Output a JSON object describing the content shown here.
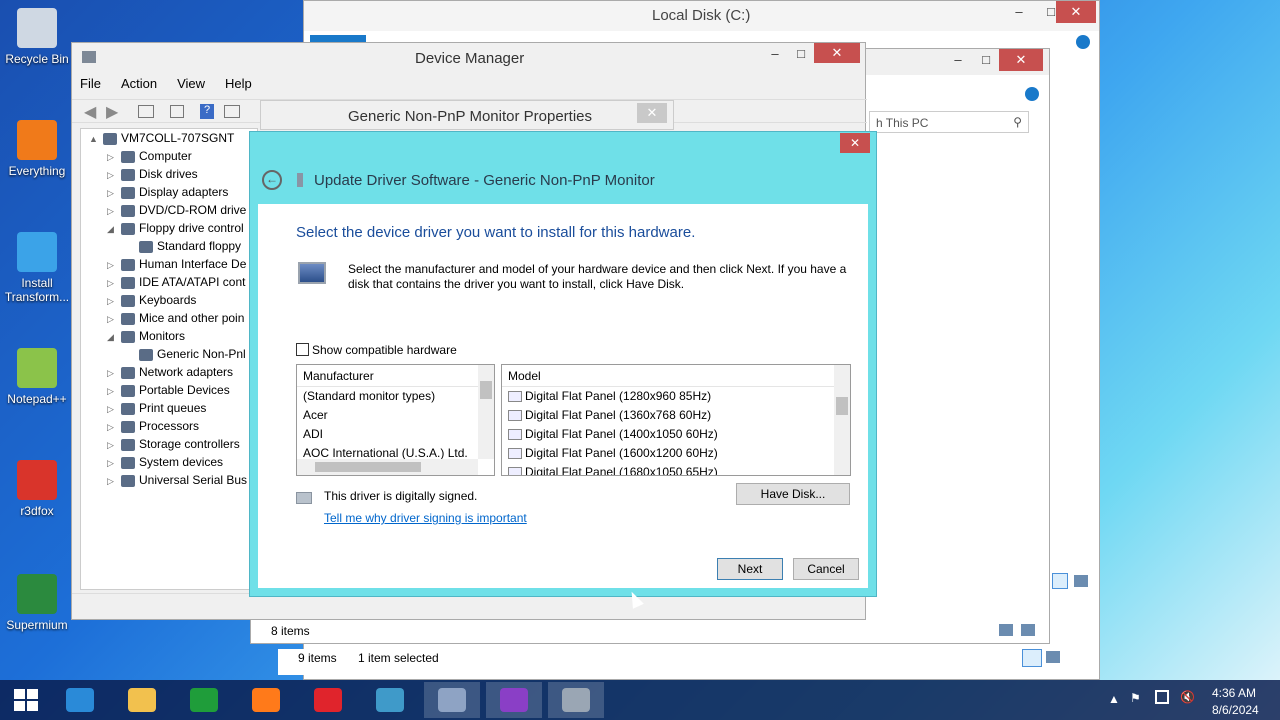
{
  "desktop": {
    "icons": [
      {
        "label": "Recycle Bin",
        "icon": "recycle-bin-icon",
        "color": "#cfd8e3"
      },
      {
        "label": "Everything",
        "icon": "everything-icon",
        "color": "#f07a1a"
      },
      {
        "label": "Install Transform...",
        "icon": "install-icon",
        "color": "#3ba3e8"
      },
      {
        "label": "Notepad++",
        "icon": "notepadpp-icon",
        "color": "#8bc34a"
      },
      {
        "label": "r3dfox",
        "icon": "r3dfox-icon",
        "color": "#d9342b"
      },
      {
        "label": "Supermium",
        "icon": "supermium-icon",
        "color": "#2b8a3e"
      }
    ]
  },
  "explorer_back": {
    "title": "Local Disk (C:)",
    "status_items": "9 items",
    "status_selected": "1 item selected"
  },
  "explorer_mid": {
    "search_placeholder": "h This PC",
    "status_items": "8 items"
  },
  "device_manager": {
    "title": "Device Manager",
    "menu": [
      "File",
      "Action",
      "View",
      "Help"
    ],
    "tree": [
      {
        "label": "VM7COLL-707SGNT",
        "level": 0,
        "arrow": "▲"
      },
      {
        "label": "Computer",
        "level": 1,
        "arrow": "▷"
      },
      {
        "label": "Disk drives",
        "level": 1,
        "arrow": "▷"
      },
      {
        "label": "Display adapters",
        "level": 1,
        "arrow": "▷"
      },
      {
        "label": "DVD/CD-ROM drive",
        "level": 1,
        "arrow": "▷"
      },
      {
        "label": "Floppy drive control",
        "level": 1,
        "arrow": "◢"
      },
      {
        "label": "Standard floppy",
        "level": 2,
        "arrow": ""
      },
      {
        "label": "Human Interface De",
        "level": 1,
        "arrow": "▷"
      },
      {
        "label": "IDE ATA/ATAPI cont",
        "level": 1,
        "arrow": "▷"
      },
      {
        "label": "Keyboards",
        "level": 1,
        "arrow": "▷"
      },
      {
        "label": "Mice and other poin",
        "level": 1,
        "arrow": "▷"
      },
      {
        "label": "Monitors",
        "level": 1,
        "arrow": "◢"
      },
      {
        "label": "Generic Non-Pnl",
        "level": 2,
        "arrow": ""
      },
      {
        "label": "Network adapters",
        "level": 1,
        "arrow": "▷"
      },
      {
        "label": "Portable Devices",
        "level": 1,
        "arrow": "▷"
      },
      {
        "label": "Print queues",
        "level": 1,
        "arrow": "▷"
      },
      {
        "label": "Processors",
        "level": 1,
        "arrow": "▷"
      },
      {
        "label": "Storage controllers",
        "level": 1,
        "arrow": "▷"
      },
      {
        "label": "System devices",
        "level": 1,
        "arrow": "▷"
      },
      {
        "label": "Universal Serial Bus",
        "level": 1,
        "arrow": "▷"
      }
    ]
  },
  "props": {
    "title": "Generic Non-PnP Monitor Properties"
  },
  "dialog": {
    "title": "Update Driver Software - Generic Non-PnP Monitor",
    "heading": "Select the device driver you want to install for this hardware.",
    "instructions": "Select the manufacturer and model of your hardware device and then click Next. If you have a disk that contains the driver you want to install, click Have Disk.",
    "checkbox_label": "Show compatible hardware",
    "manufacturer_header": "Manufacturer",
    "manufacturers": [
      "(Standard monitor types)",
      "Acer",
      "ADI",
      "AOC International (U.S.A.) Ltd."
    ],
    "model_header": "Model",
    "models": [
      "Digital Flat Panel (1280x960 85Hz)",
      "Digital Flat Panel (1360x768 60Hz)",
      "Digital Flat Panel (1400x1050 60Hz)",
      "Digital Flat Panel (1600x1200 60Hz)",
      "Digital Flat Panel (1680x1050 65Hz)"
    ],
    "signed_text": "This driver is digitally signed.",
    "link": "Tell me why driver signing is important",
    "have_disk": "Have Disk...",
    "next": "Next",
    "cancel": "Cancel"
  },
  "taskbar": {
    "time": "4:36 AM",
    "date": "8/6/2024",
    "apps": [
      {
        "icon": "internet-explorer-icon",
        "color": "#2a8ad8"
      },
      {
        "icon": "file-explorer-icon",
        "color": "#f2c14e"
      },
      {
        "icon": "store-icon",
        "color": "#1f9d3a"
      },
      {
        "icon": "firefox-icon",
        "color": "#ff7a1a"
      },
      {
        "icon": "opera-icon",
        "color": "#e0242c"
      },
      {
        "icon": "photos-icon",
        "color": "#3f9ac9"
      },
      {
        "icon": "keyboard-icon",
        "color": "#8ea3c4"
      },
      {
        "icon": "magnifier-icon",
        "color": "#8a3fc6"
      },
      {
        "icon": "device-manager-icon",
        "color": "#9aa6b4"
      }
    ]
  }
}
